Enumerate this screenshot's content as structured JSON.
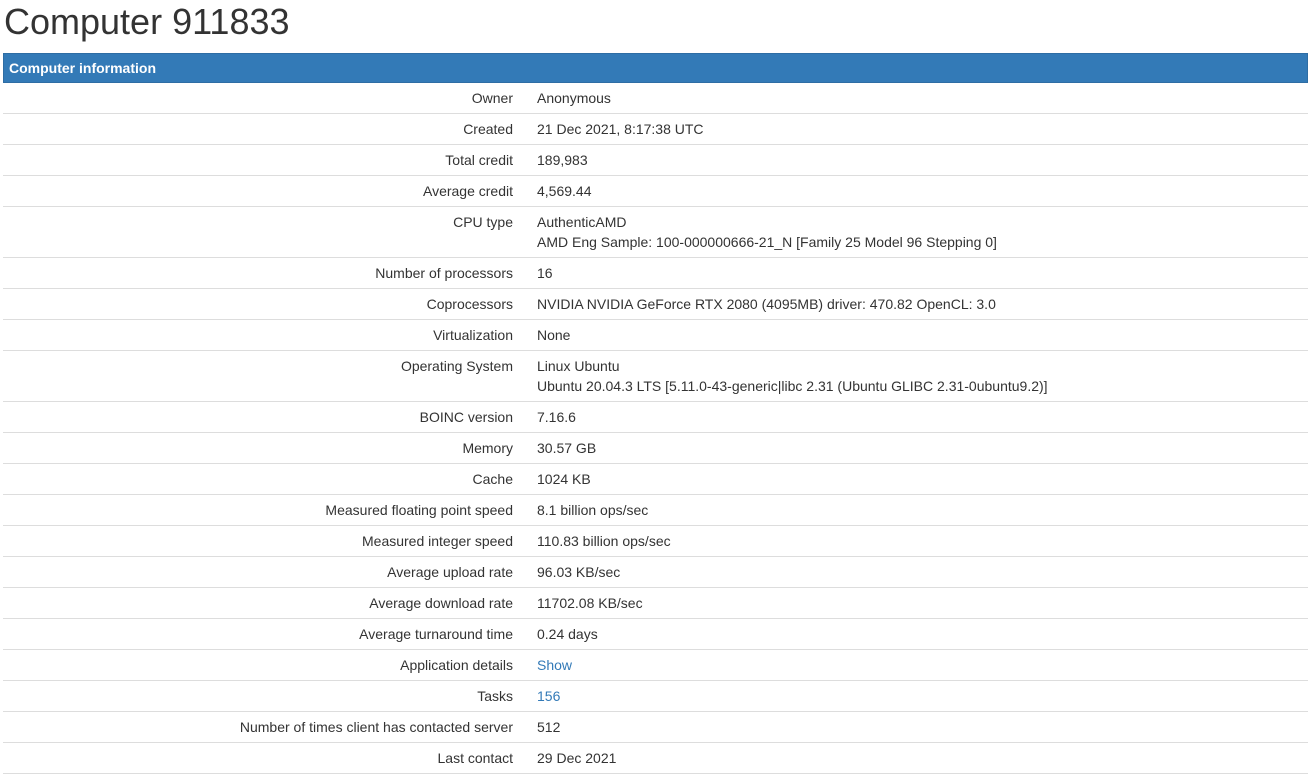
{
  "page": {
    "title": "Computer 911833"
  },
  "panel": {
    "heading": "Computer information"
  },
  "rows": {
    "owner": {
      "label": "Owner",
      "value": "Anonymous"
    },
    "created": {
      "label": "Created",
      "value": "21 Dec 2021, 8:17:38 UTC"
    },
    "total_credit": {
      "label": "Total credit",
      "value": "189,983"
    },
    "average_credit": {
      "label": "Average credit",
      "value": "4,569.44"
    },
    "cpu_type": {
      "label": "CPU type",
      "line1": "AuthenticAMD",
      "line2": "AMD Eng Sample: 100-000000666-21_N [Family 25 Model 96 Stepping 0]"
    },
    "num_processors": {
      "label": "Number of processors",
      "value": "16"
    },
    "coprocessors": {
      "label": "Coprocessors",
      "value": "NVIDIA NVIDIA GeForce RTX 2080 (4095MB) driver: 470.82 OpenCL: 3.0"
    },
    "virtualization": {
      "label": "Virtualization",
      "value": "None"
    },
    "os": {
      "label": "Operating System",
      "line1": "Linux Ubuntu",
      "line2": "Ubuntu 20.04.3 LTS [5.11.0-43-generic|libc 2.31 (Ubuntu GLIBC 2.31-0ubuntu9.2)]"
    },
    "boinc_version": {
      "label": "BOINC version",
      "value": "7.16.6"
    },
    "memory": {
      "label": "Memory",
      "value": "30.57 GB"
    },
    "cache": {
      "label": "Cache",
      "value": "1024 KB"
    },
    "fp_speed": {
      "label": "Measured floating point speed",
      "value": "8.1 billion ops/sec"
    },
    "int_speed": {
      "label": "Measured integer speed",
      "value": "110.83 billion ops/sec"
    },
    "upload_rate": {
      "label": "Average upload rate",
      "value": "96.03 KB/sec"
    },
    "download_rate": {
      "label": "Average download rate",
      "value": "11702.08 KB/sec"
    },
    "turnaround": {
      "label": "Average turnaround time",
      "value": "0.24 days"
    },
    "app_details": {
      "label": "Application details",
      "value": "Show"
    },
    "tasks": {
      "label": "Tasks",
      "value": "156"
    },
    "contacts": {
      "label": "Number of times client has contacted server",
      "value": "512"
    },
    "last_contact": {
      "label": "Last contact",
      "value": "29 Dec 2021"
    }
  },
  "colors": {
    "heading_bg": "#337ab7",
    "link": "#337ab7",
    "text": "#333333",
    "divider": "#dddddd"
  }
}
